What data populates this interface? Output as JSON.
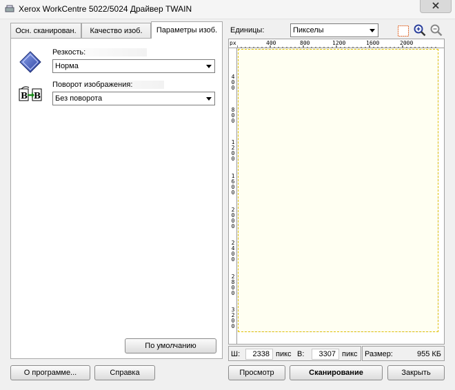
{
  "window": {
    "title": "Xerox WorkCentre 5022/5024 Драйвер TWAIN"
  },
  "tabs": [
    {
      "label": "Осн. сканирован."
    },
    {
      "label": "Качество изоб."
    },
    {
      "label": "Параметры изоб."
    }
  ],
  "settings": {
    "sharpness_label": "Резкость:",
    "sharpness_value": "Норма",
    "rotation_label": "Поворот изображения:",
    "rotation_value": "Без поворота",
    "default_button": "По умолчанию"
  },
  "units": {
    "label": "Единицы:",
    "value": "Пикселы"
  },
  "ruler": {
    "unit": "px",
    "top_ticks": [
      "400",
      "800",
      "1200",
      "1600",
      "2000"
    ],
    "left_ticks": [
      "400",
      "800",
      "1200",
      "1600",
      "2000",
      "2400",
      "2800",
      "3200"
    ]
  },
  "status": {
    "width_label": "Ш:",
    "width_value": "2338",
    "width_unit": "пикс",
    "height_label": "В:",
    "height_value": "3307",
    "height_unit": "пикс",
    "size_label": "Размер:",
    "size_value": "955 КБ"
  },
  "buttons": {
    "about": "О программе...",
    "help": "Справка",
    "preview": "Просмотр",
    "scan": "Сканирование",
    "close": "Закрыть"
  },
  "colors": {
    "accent_blue": "#3355cc",
    "scan_area_bg": "#fffff2"
  },
  "icons": {
    "app": "scanner-icon",
    "close": "close-icon",
    "sharpness": "diamond-sharpness-icon",
    "rotation": "rotate-image-icon",
    "select_area": "select-area-icon",
    "zoom_in": "zoom-in-icon",
    "zoom_out": "zoom-out-icon"
  }
}
